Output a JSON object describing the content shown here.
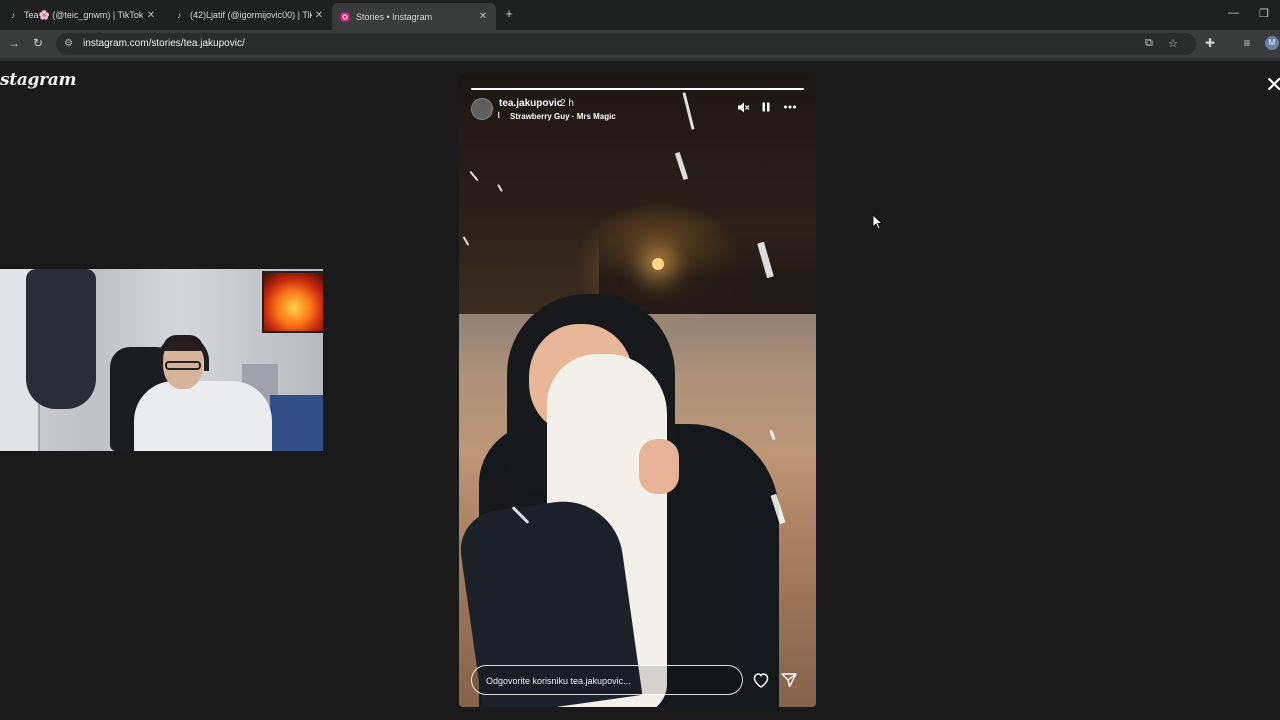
{
  "browser": {
    "tabs": [
      {
        "title": "Tea🌸 (@teic_gnwm) | TikTok",
        "icon": "tiktok-icon",
        "active": false
      },
      {
        "title": "(42)Ljatif (@igormijovic00) | Tik",
        "icon": "tiktok-icon",
        "active": false
      },
      {
        "title": "Stories • Instagram",
        "icon": "instagram-icon",
        "active": true
      }
    ],
    "new_tab_label": "+",
    "url": "instagram.com/stories/tea.jakupovic/",
    "profile_initial": "M"
  },
  "page": {
    "logo": "stagram",
    "close_label": "✕"
  },
  "story": {
    "username": "tea.jakupovic",
    "time": "2 h",
    "music": "Strawberry Guy · Mrs Magic",
    "progress": 1.0,
    "reply_placeholder": "Odgovorite korisniku tea.jakupovic..."
  },
  "colors": {
    "page_bg": "#1a1a1a",
    "tabstrip_bg": "#1f2020",
    "toolbar_bg": "#3a3b3b"
  }
}
